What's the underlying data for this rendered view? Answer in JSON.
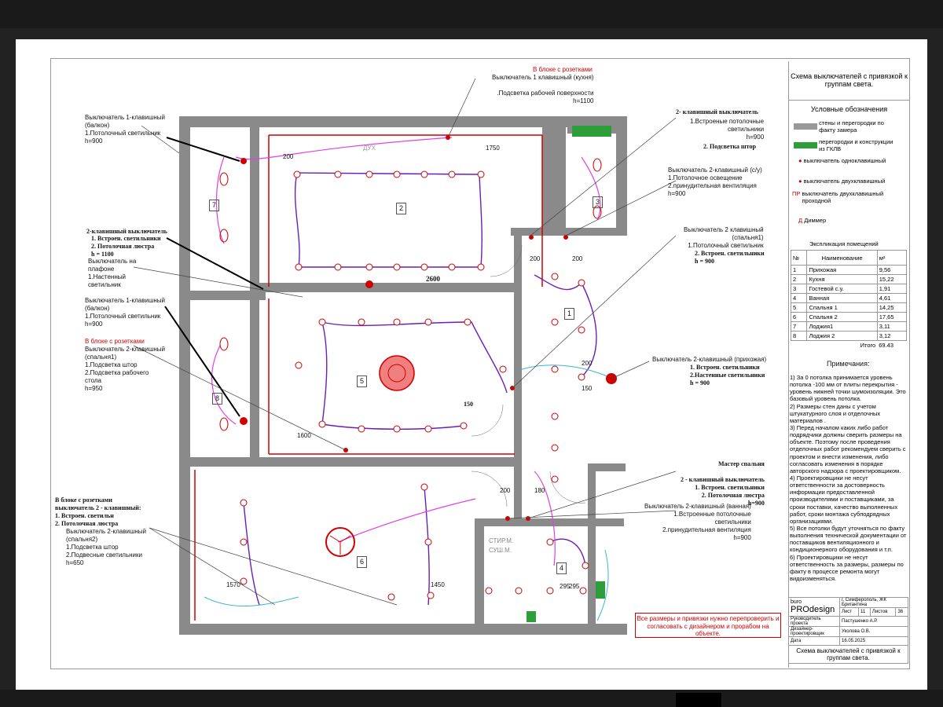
{
  "title_block": {
    "title": "Схема выключателей с привязкой к группам света.",
    "legend_heading": "Условные обозначения",
    "legend": [
      {
        "label": "стены и перегородки по факту замера",
        "color": "#999999"
      },
      {
        "label": "перегородки и конструкции из ГКЛВ",
        "color": "#2e9e3a"
      },
      {
        "label": "выключатель одноклавишный",
        "color": "#cc0000"
      },
      {
        "label": "выключатель двухклавишный",
        "color": "#cc0000"
      },
      {
        "label": "выключатель двухклавишный проходной",
        "color": "#cc0000"
      },
      {
        "label": "Диммер",
        "color": "#cc0000"
      }
    ],
    "pr_label": "ПР",
    "d_label": "Д",
    "room_table_heading": "Экспликация помещений",
    "room_table_header": [
      "№",
      "Наименование",
      "м²"
    ],
    "rooms": [
      [
        "1",
        "Прихожая",
        "9,56"
      ],
      [
        "2",
        "Кухня",
        "15,22"
      ],
      [
        "3",
        "Гостевой с.у.",
        "1,91"
      ],
      [
        "4",
        "Ванная",
        "4,61"
      ],
      [
        "5",
        "Спальня 1",
        "14,25"
      ],
      [
        "6",
        "Спальня 2",
        "17,65"
      ],
      [
        "7",
        "Лоджия1",
        "3,11"
      ],
      [
        "8",
        "Лоджия 2",
        "3,12"
      ]
    ],
    "total_label": "Итого",
    "total_value": "69.43",
    "notes_heading": "Примечания:",
    "notes": [
      "1)      За 0 потолка принимается уровень потолка -100 мм от плиты перекрытия - уровень нижней точки шумоизоляции. Это базовый уровень потолка.",
      "2)      Размеры стен даны с учетом штукатурного слоя и отделочных материалов .",
      "3)      Перед началом каких либо работ подрядчики должны сверить размеры на объекте. Поэтому после проведения отделочных работ рекомендуем сверить с проектом и внести изменения, либо согласовать изменения в порядке авторского надзора с проектировщиком.",
      "4)      Проектировщики не несут ответственности за достоверность информации предоставленной производителями и поставщиками, за сроки поставки, качество выполненных работ, сроки монтажа субподрядных организациями.",
      "5)      Все потолки будут уточняться по факту выполнения технической документации от поставщиков вентиляционного и кондиционерного оборудования и т.п.",
      "6)      Проектировщики не несут ответственность за размеры, размеры по факту в процессе ремонта могут видоизменяться."
    ],
    "stamp": {
      "logo_top": "buro",
      "logo_main": "PROdesign",
      "city": "г. Симферополь, ЖК Бригантина",
      "sheet_label": "Лист",
      "sheet_no": "11",
      "sheets_label": "Листов",
      "sheets_total": "36",
      "lead_label": "Руководитель проекта",
      "lead_name": "Пастушенко А.Р.",
      "designer_label": "Дизайнер-проектировщик",
      "designer_name": "Уколова О.В.",
      "date_label": "Дата",
      "date": "16.05.2025",
      "bottom_title": "Схема выключателей с привязкой к группам света."
    }
  },
  "warning": "Все размеры и привязки нужно перепроверить и согласовать с дизайнером и прорабом на объекте.",
  "annotations": [
    {
      "id": "kitchen-top",
      "text": "Выключатель 1 клавишный  (кухня)\n\n.Подсветка рабочей поверхности\nh=1100",
      "head": "В блоке с розетками"
    },
    {
      "id": "balcony-1",
      "text": "Выключатель 1-клавишный\n(балкон)\n1.Потолочный светильник\nh=900"
    },
    {
      "id": "two-key-right",
      "text": "1.Встроеные потолочные\nсветильники\nh=900",
      "head": "2- клавишный выключатель",
      "extra": "2. Подсветка штор"
    },
    {
      "id": "su",
      "text": "Выключатель 2-клавишный  (с/у)\n1.Потолочное освещение\n2.принудительная вентиляция\nh=900"
    },
    {
      "id": "bed1-two",
      "text": "Выключатель 2 клавишный\n(спальня1)\n1.Потолочный светильник",
      "extra": "2. Встроен. светильники\nh = 900"
    },
    {
      "id": "bed1-left",
      "text": "1. Встроен. светильники\n2. Потолочная люстра\nh = 1100",
      "head": "2-клавишный выключатель"
    },
    {
      "id": "plafond",
      "text": "Выключатель на\nплафоне\n1.Настенный\nсветильник"
    },
    {
      "id": "balcony-2",
      "text": "Выключатель 1-клавишный\n(балкон)\n1.Потолочный светильник\nh=900"
    },
    {
      "id": "bed1-sockets",
      "text": "Выключатель 2-клавишный\n(спальня1)\n1.Подсветка штор\n2.Подсветка рабочего\nстола\nh=950",
      "head": "В блоке с розетками"
    },
    {
      "id": "hall",
      "text": "Выключатель 2-клавишный  (прихожая)",
      "extra": "1. Встроен. светильники\n2.Настенные светильники\nh = 900"
    },
    {
      "id": "master",
      "text": "Мастер спальня\n\n2 - клавишный выключатель\n1. Встроен. светильники\n2. Потолочная люстра\nh=900"
    },
    {
      "id": "bath",
      "text": "Выключатель 2-клавишный  (ванная)\n1.Встроенные потолочные\nсветильники\n2.принудительная вентиляция\nh=900"
    },
    {
      "id": "bed2-sockets",
      "head": "В блоке с розетками\nвыключатель 2 - клавишный:\n1. Встроен. светильн\n2. Потолочная люстра",
      "text": "Выключатель 2-клавишный\n(спальня2)\n1.Подсветка штор\n2.Подвесные светильники\nh=650"
    }
  ],
  "dimensions": [
    "1750",
    "200",
    "2600",
    "200",
    "200",
    "200",
    "150",
    "150",
    "1600",
    "200",
    "180",
    "1570",
    "1450",
    "295",
    "295"
  ],
  "room_numbers": [
    "1",
    "2",
    "3",
    "4",
    "5",
    "6",
    "7",
    "8"
  ],
  "fixture_labels": [
    "ДУХ",
    "СТИР.М.",
    "СУШ.М."
  ]
}
